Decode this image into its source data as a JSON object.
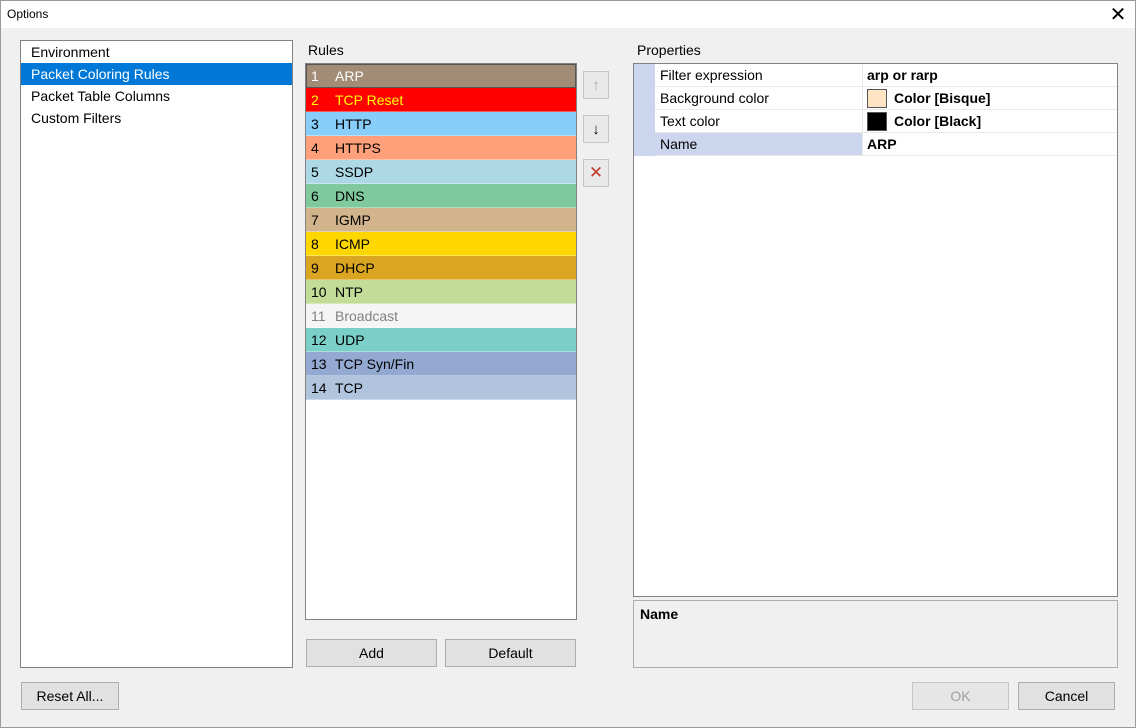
{
  "window": {
    "title": "Options",
    "close_glyph": "✕"
  },
  "nav": {
    "items": [
      {
        "label": "Environment",
        "selected": false
      },
      {
        "label": "Packet Coloring Rules",
        "selected": true
      },
      {
        "label": "Packet Table Columns",
        "selected": false
      },
      {
        "label": "Custom Filters",
        "selected": false
      }
    ]
  },
  "rules": {
    "label": "Rules",
    "items": [
      {
        "num": "1",
        "name": "ARP",
        "bg": "#a28c76",
        "fg": "#ffffff",
        "selected": true
      },
      {
        "num": "2",
        "name": "TCP Reset",
        "bg": "#ff0000",
        "fg": "#ffff00"
      },
      {
        "num": "3",
        "name": "HTTP",
        "bg": "#87cefa",
        "fg": "#000000"
      },
      {
        "num": "4",
        "name": "HTTPS",
        "bg": "#ffa07a",
        "fg": "#000000"
      },
      {
        "num": "5",
        "name": "SSDP",
        "bg": "#add8e6",
        "fg": "#000000"
      },
      {
        "num": "6",
        "name": "DNS",
        "bg": "#7fc99c",
        "fg": "#000000"
      },
      {
        "num": "7",
        "name": "IGMP",
        "bg": "#d2b48c",
        "fg": "#000000"
      },
      {
        "num": "8",
        "name": "ICMP",
        "bg": "#ffd700",
        "fg": "#000000"
      },
      {
        "num": "9",
        "name": "DHCP",
        "bg": "#daa520",
        "fg": "#000000"
      },
      {
        "num": "10",
        "name": "NTP",
        "bg": "#c3dd98",
        "fg": "#000000"
      },
      {
        "num": "11",
        "name": "Broadcast",
        "bg": "#f5f5f5",
        "fg": "#808080"
      },
      {
        "num": "12",
        "name": "UDP",
        "bg": "#7ad0c8",
        "fg": "#000000"
      },
      {
        "num": "13",
        "name": "TCP Syn/Fin",
        "bg": "#93a9d2",
        "fg": "#000000"
      },
      {
        "num": "14",
        "name": "TCP",
        "bg": "#b0c4de",
        "fg": "#000000"
      }
    ],
    "move_up_icon": "↑",
    "move_down_icon": "↓",
    "delete_icon": "✕",
    "add_label": "Add",
    "default_label": "Default"
  },
  "properties": {
    "label": "Properties",
    "rows": {
      "filter": {
        "name": "Filter expression",
        "value": "arp or rarp"
      },
      "background": {
        "name": "Background color",
        "value": "Color [Bisque]",
        "swatch": "#ffe4c4"
      },
      "text": {
        "name": "Text color",
        "value": "Color [Black]",
        "swatch": "#000000"
      },
      "name": {
        "name": "Name",
        "value": "ARP"
      }
    },
    "description_title": "Name"
  },
  "footer": {
    "reset_label": "Reset All...",
    "ok_label": "OK",
    "cancel_label": "Cancel"
  }
}
